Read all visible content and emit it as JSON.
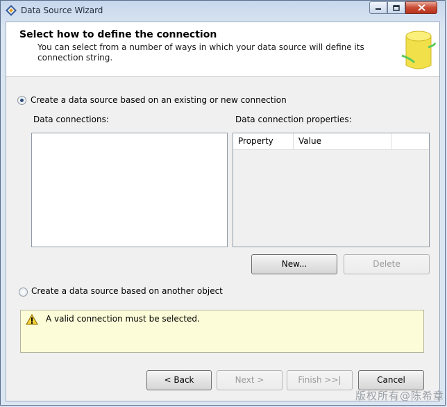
{
  "window": {
    "title": "Data Source Wizard"
  },
  "header": {
    "title": "Select how to define the connection",
    "description": "You can select from a number of ways in which your data source will define its connection string."
  },
  "option_existing": {
    "label": "Create a data source based on an existing or new connection",
    "checked": true
  },
  "connections": {
    "label": "Data connections:",
    "items": []
  },
  "properties": {
    "label": "Data connection properties:",
    "columns": [
      "Property",
      "Value"
    ]
  },
  "buttons": {
    "new": "New...",
    "delete": "Delete",
    "back": "< Back",
    "next": "Next >",
    "finish": "Finish >>|",
    "cancel": "Cancel"
  },
  "option_object": {
    "label": "Create a data source based on another object",
    "checked": false
  },
  "warning": {
    "message": "A valid connection must be selected."
  },
  "watermark": "版权所有@陈希章",
  "colors": {
    "warning_bg": "#fcfcd8",
    "accent": "#2b4b7a"
  }
}
